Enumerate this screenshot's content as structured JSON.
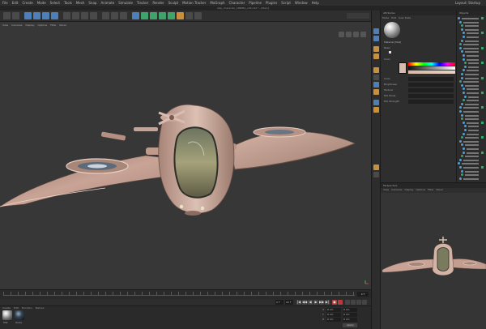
{
  "app": {
    "title": "ship_character_CINEMA_v03.c4d * - [Main]",
    "layout": "Layout: Startup"
  },
  "menu": [
    "File",
    "Edit",
    "Create",
    "Mode",
    "Select",
    "Tools",
    "Mesh",
    "Snap",
    "Animate",
    "Simulate",
    "Tracker",
    "Render",
    "Sculpt",
    "Motion Tracker",
    "MoGraph",
    "Character",
    "Pipeline",
    "Plugins",
    "Script",
    "Window",
    "Help"
  ],
  "viewport": {
    "hud": [
      "View",
      "Cameras",
      "Display",
      "Options",
      "Filter",
      "Panel"
    ],
    "model_color": "#c9a496",
    "background": "#373737"
  },
  "timeline": {
    "current_frame": "0 F"
  },
  "playback": {
    "start": "0 F",
    "end": "90 F",
    "buttons": [
      "|◀",
      "◀◀",
      "◀",
      "▶",
      "▶▶",
      "▶|",
      "●"
    ]
  },
  "materials": {
    "menu": [
      "Create",
      "Edit",
      "Function",
      "Texture"
    ],
    "items": [
      {
        "name": "Mat"
      },
      {
        "name": "Glass"
      }
    ]
  },
  "coordinates": {
    "rows": [
      {
        "axis": "X",
        "pos": "0 cm",
        "size": "0 cm"
      },
      {
        "axis": "Y",
        "pos": "0 cm",
        "size": "0 cm"
      },
      {
        "axis": "Z",
        "pos": "0 cm",
        "size": "0 cm"
      }
    ],
    "apply_label": "Apply"
  },
  "attributes": {
    "title": "Attributes",
    "tabs": [
      "Mode",
      "Edit",
      "User Data"
    ],
    "material_label": "Material [Mat]",
    "rows": [
      "Basic",
      "Color",
      "Color",
      "Brightness",
      "Texture",
      "Mix Mode",
      "Mix Strength"
    ]
  },
  "objects": {
    "title": "Objects"
  },
  "preview": {
    "title": "Perspective",
    "menu": [
      "View",
      "Cameras",
      "Display",
      "Options",
      "Filter",
      "Panel"
    ]
  },
  "palette_icons": [
    "move-icon",
    "scale-icon",
    "rotate-icon",
    "select-icon",
    "model-mode-icon",
    "points-mode-icon",
    "edges-mode-icon",
    "polygons-mode-icon",
    "axis-icon",
    "texture-icon",
    "snap-icon",
    "workplane-icon"
  ]
}
